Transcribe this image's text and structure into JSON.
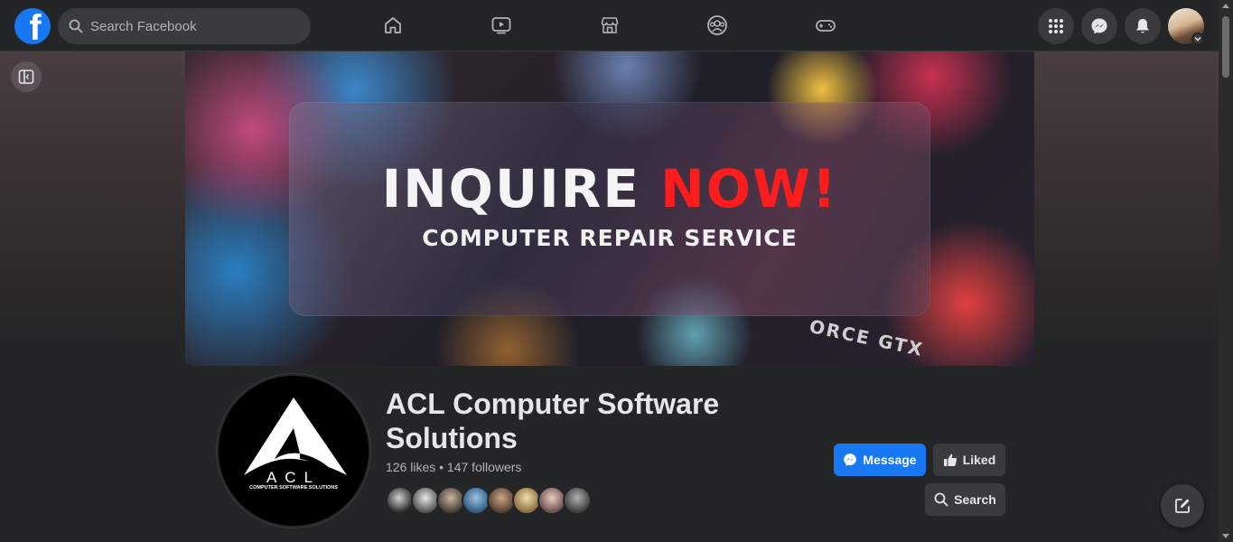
{
  "topbar": {
    "search_placeholder": "Search Facebook",
    "logo_letter": "f",
    "nav_icons": [
      "home-icon",
      "video-icon",
      "marketplace-icon",
      "groups-icon",
      "gaming-icon"
    ],
    "right_icons": [
      "menu-grid-icon",
      "messenger-icon",
      "notifications-icon"
    ]
  },
  "cover": {
    "headline_white": "INQUIRE",
    "headline_red": "NOW!",
    "subtitle": "COMPUTER REPAIR SERVICE",
    "gpu_text": "ORCE GTX"
  },
  "profile": {
    "logo_text": "ACL",
    "logo_subtext": "COMPUTER SOFTWARE SOLUTIONS",
    "page_name": "ACL Computer Software Solutions",
    "stats": "126 likes • 147 followers",
    "friend_avatar_count": 8
  },
  "actions": {
    "message_label": "Message",
    "liked_label": "Liked",
    "search_label": "Search"
  },
  "colors": {
    "accent": "#1877f2",
    "surface": "#242526",
    "button": "#3a3b3c",
    "text": "#e4e6eb",
    "muted": "#b0b3b8",
    "headline_red": "#ff1c1c"
  }
}
